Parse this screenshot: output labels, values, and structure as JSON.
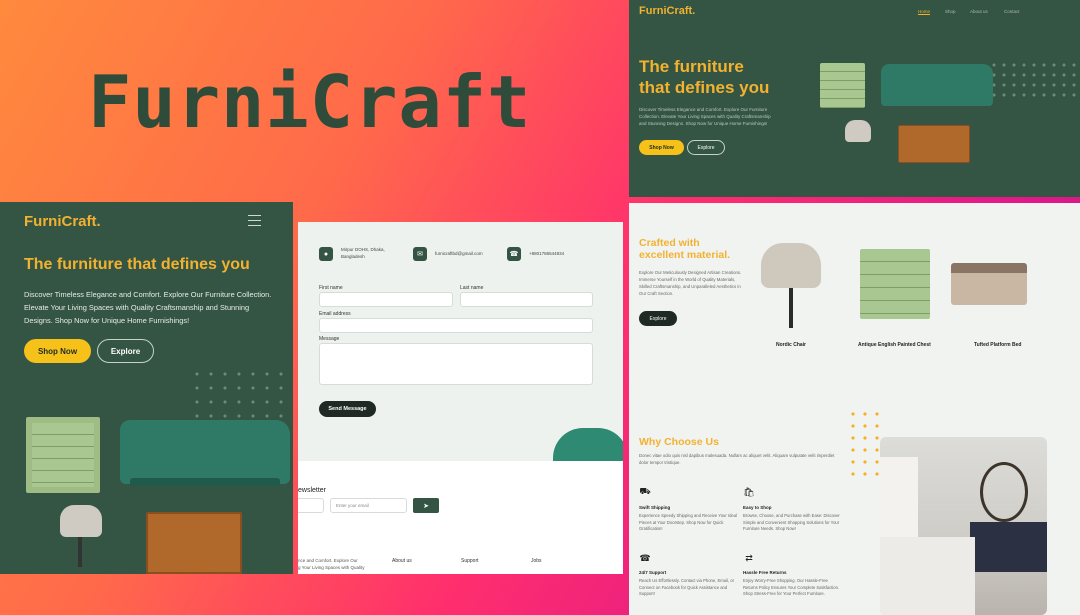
{
  "banner": {
    "title": "FurniCraft"
  },
  "mobile": {
    "brand": "FurniCraft",
    "headline": "The furniture that defines you",
    "desc": "Discover Timeless Elegance and Comfort. Explore Our Furniture Collection. Elevate Your Living Spaces with Quality Craftsmanship and Stunning Designs. Shop Now for Unique Home Furnishings!",
    "shop": "Shop Now",
    "explore": "Explore"
  },
  "contact": {
    "address": "Mirpur DOHS, Dhaka, Bangladesh",
    "email": "furnicraftbd@gmail.com",
    "phone": "+8801786544934",
    "first_name": "First name",
    "last_name": "Last name",
    "email_label": "Email address",
    "message": "Message",
    "send": "Send Message",
    "newsletter": "ewsletter",
    "email_placeholder": "Enter your email",
    "footer_text1": "nce and Comfort. Explore Our",
    "footer_text2": "g Your Living Spaces with Quality",
    "footer_cols": [
      "About us",
      "Support",
      "Jobs"
    ]
  },
  "desktop": {
    "brand": "FurniCraft",
    "nav": [
      "Home",
      "Shop",
      "About us",
      "Contact"
    ],
    "hero_line1": "The furniture",
    "hero_line2": "that defines you",
    "hero_desc": "Discover Timeless Elegance and Comfort. Explore Our Furniture Collection. Elevate Your Living Spaces with Quality Craftsmanship and Stunning Designs. Shop Now for Unique Home Furnishings!",
    "shop": "Shop Now",
    "explore": "Explore"
  },
  "crafted": {
    "line1": "Crafted with",
    "line2": "excellent material.",
    "desc": "Explore Our Meticulously Designed Artisan Creations. Immerse Yourself in the World of Quality Materials, Skilled Craftsmanship, and Unparalleled Aesthetics in Our Craft Section.",
    "explore": "Explore",
    "products": [
      "Nordic Chair",
      "Antique English Painted Chest",
      "Tufted Platform Bed"
    ]
  },
  "why": {
    "title": "Why Choose Us",
    "desc": "Donec vitae odio quis nisl dapibus malesuada. Nullam ac aliquet velit. Aliquam vulputate velit imperdiet dolor tempor tristique.",
    "features": [
      {
        "title": "Swift Shipping",
        "text": "Experience Speedy Shipping and Receive Your Ideal Pieces at Your Doorstep. Shop Now for Quick Gratification!"
      },
      {
        "title": "Easy to Shop",
        "text": "Browse, Choose, and Purchase with Ease: Discover Simple and Convenient Shopping Solutions for Your Furniture Needs. Shop Now!"
      },
      {
        "title": "24/7 Support",
        "text": "Reach Us Effortlessly. Contact via Phone, Email, or Connect on Facebook for Quick Assistance and Support!"
      },
      {
        "title": "Hassle Free Returns",
        "text": "Enjoy Worry-Free Shopping. Our Hassle-Free Returns Policy Ensures Your Complete Satisfaction. Shop Stress-Free for Your Perfect Furniture."
      }
    ]
  },
  "colors": {
    "green": "#355544",
    "yellow": "#f6c21a",
    "accent": "#f2b230",
    "bg_gradient_start": "#ff8a3d",
    "bg_gradient_end": "#c0157f"
  }
}
